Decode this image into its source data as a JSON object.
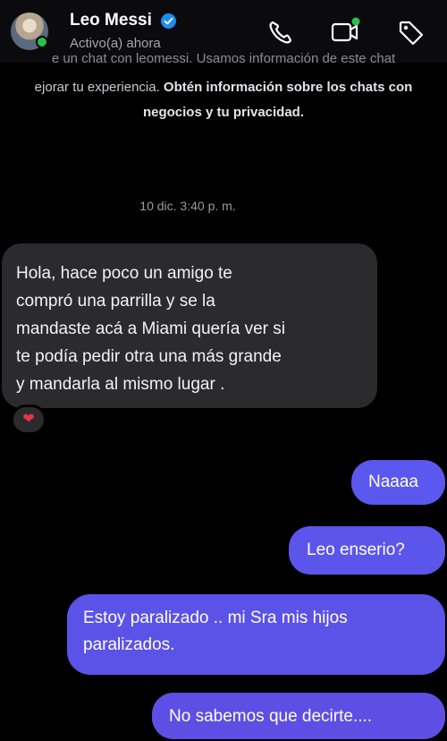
{
  "header": {
    "contact_name": "Leo Messi",
    "status": "Activo(a) ahora"
  },
  "notice": {
    "line1": "e un chat con leomessi. Usamos información de este chat",
    "line2_text": "ejorar tu experiencia. ",
    "line2_link": "Obtén información sobre los chats con",
    "line3_link": "negocios y tu privacidad."
  },
  "conversation": {
    "timestamp": "10 dic. 3:40 p. m.",
    "incoming": [
      {
        "text": "Hola, hace poco un amigo te compró una parrilla y se la mandaste acá a Miami quería ver si te podía pedir otra una más grande y mandarla al mismo lugar .",
        "lines": [
          "Hola, hace poco un amigo te",
          "compró una parrilla y se la",
          "mandaste acá a Miami quería ver si",
          "te podía pedir otra una más grande",
          "y mandarla al mismo lugar ."
        ],
        "reaction": "heart"
      }
    ],
    "outgoing": [
      {
        "text": "Naaaa"
      },
      {
        "text": "Leo enserio?"
      },
      {
        "text": "Estoy paralizado .. mi Sra mis hijos paralizados.",
        "lines": [
          "Estoy paralizado .. mi Sra mis hijos",
          "paralizados."
        ]
      },
      {
        "text": "No sabemos que decirte...."
      }
    ]
  },
  "colors": {
    "background": "#000000",
    "incoming_bubble": "#2b2b2e",
    "outgoing_bubble": "#5a55ec",
    "verified": "#1d8ef0",
    "presence": "#2fbf4a",
    "reaction_heart": "#e8344a"
  },
  "icons": {
    "header": [
      "phone-icon",
      "video-call-icon",
      "tag-icon"
    ],
    "reaction": "heart-icon"
  }
}
